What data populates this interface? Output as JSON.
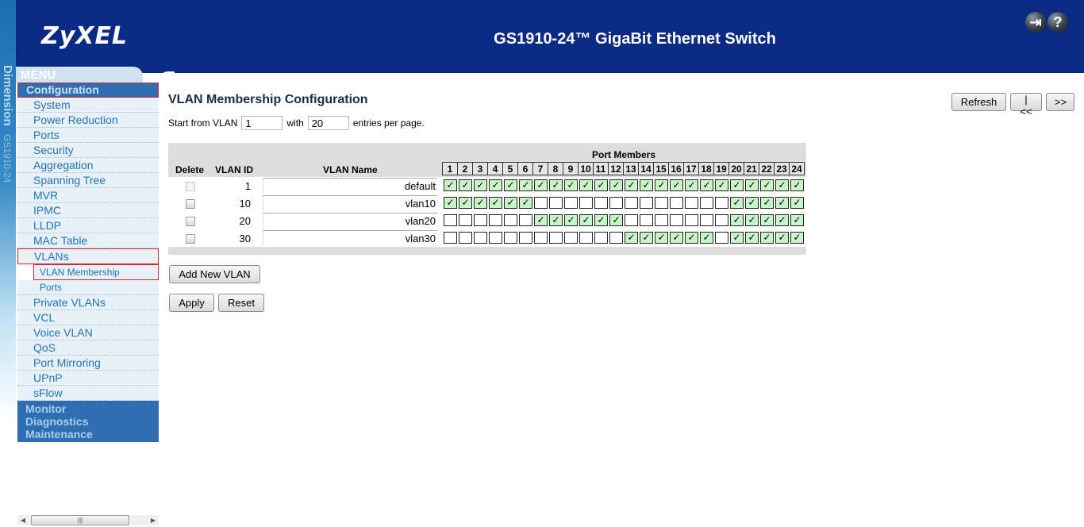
{
  "header": {
    "logo": "ZyXEL",
    "title": "GS1910-24™ GigaBit Ethernet Switch",
    "icons": [
      "logout-icon",
      "help-icon"
    ]
  },
  "strip": {
    "brand": "Dimension",
    "model": "GS1910-24"
  },
  "menu": {
    "label": "MENU",
    "active_section": "Configuration",
    "items": [
      {
        "label": "System"
      },
      {
        "label": "Power Reduction"
      },
      {
        "label": "Ports"
      },
      {
        "label": "Security"
      },
      {
        "label": "Aggregation"
      },
      {
        "label": "Spanning Tree"
      },
      {
        "label": "MVR"
      },
      {
        "label": "IPMC"
      },
      {
        "label": "LLDP"
      },
      {
        "label": "MAC Table"
      },
      {
        "label": "VLANs",
        "selected": true
      },
      {
        "label": "VLAN Membership",
        "sub": true,
        "selected": true
      },
      {
        "label": "Ports",
        "sub": true
      },
      {
        "label": "Private VLANs"
      },
      {
        "label": "VCL"
      },
      {
        "label": "Voice VLAN"
      },
      {
        "label": "QoS"
      },
      {
        "label": "Port Mirroring"
      },
      {
        "label": "UPnP"
      },
      {
        "label": "sFlow"
      }
    ],
    "other_sections": [
      "Monitor",
      "Diagnostics",
      "Maintenance"
    ]
  },
  "page": {
    "title": "VLAN Membership Configuration",
    "start_label": "Start from VLAN",
    "start_value": "1",
    "with_label": "with",
    "entries_value": "20",
    "entries_label": "entries per page.",
    "buttons": {
      "refresh": "Refresh",
      "first": "|<<",
      "next": ">>",
      "add": "Add New VLAN",
      "apply": "Apply",
      "reset": "Reset"
    }
  },
  "table": {
    "headers": {
      "delete": "Delete",
      "vlan_id": "VLAN ID",
      "vlan_name": "VLAN Name",
      "port_members": "Port Members"
    },
    "ports": [
      "1",
      "2",
      "3",
      "4",
      "5",
      "6",
      "7",
      "8",
      "9",
      "10",
      "11",
      "12",
      "13",
      "14",
      "15",
      "16",
      "17",
      "18",
      "19",
      "20",
      "21",
      "22",
      "23",
      "24"
    ],
    "check_glyph": "✓",
    "rows": [
      {
        "id": "1",
        "name": "default",
        "delete_disabled": true,
        "members": [
          1,
          1,
          1,
          1,
          1,
          1,
          1,
          1,
          1,
          1,
          1,
          1,
          1,
          1,
          1,
          1,
          1,
          1,
          1,
          1,
          1,
          1,
          1,
          1
        ]
      },
      {
        "id": "10",
        "name": "vlan10",
        "delete_disabled": false,
        "members": [
          1,
          1,
          1,
          1,
          1,
          1,
          0,
          0,
          0,
          0,
          0,
          0,
          0,
          0,
          0,
          0,
          0,
          0,
          0,
          1,
          1,
          1,
          1,
          1
        ]
      },
      {
        "id": "20",
        "name": "vlan20",
        "delete_disabled": false,
        "members": [
          0,
          0,
          0,
          0,
          0,
          0,
          1,
          1,
          1,
          1,
          1,
          1,
          0,
          0,
          0,
          0,
          0,
          0,
          0,
          1,
          1,
          1,
          1,
          1
        ]
      },
      {
        "id": "30",
        "name": "vlan30",
        "delete_disabled": false,
        "members": [
          0,
          0,
          0,
          0,
          0,
          0,
          0,
          0,
          0,
          0,
          0,
          0,
          1,
          1,
          1,
          1,
          1,
          1,
          0,
          1,
          1,
          1,
          1,
          1
        ]
      }
    ]
  }
}
